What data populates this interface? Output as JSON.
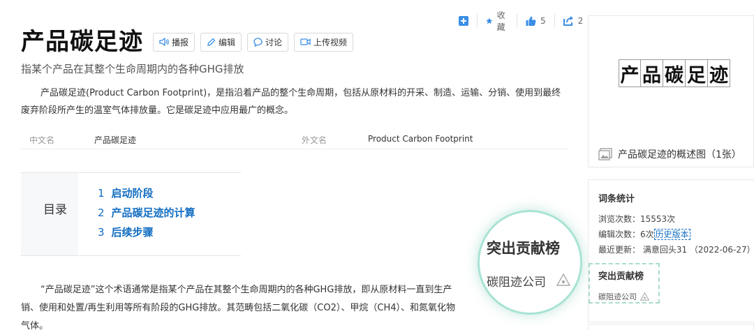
{
  "actions": {
    "collect_label": "收藏",
    "like_count": "5",
    "share_count": "2"
  },
  "title": "产品碳足迹",
  "toolbar": {
    "broadcast": "播报",
    "edit": "编辑",
    "discuss": "讨论",
    "upload_video": "上传视频"
  },
  "subtitle": "指某个产品在其整个生命周期内的各种GHG排放",
  "summary": "产品碳足迹(Product Carbon Footprint)，是指沿着产品的整个生命周期，包括从原材料的开采、制造、运输、分销、使用到最终废弃阶段所产生的温室气体排放量。它是碳足迹中应用最广的概念。",
  "basic_info": {
    "cn_name_label": "中文名",
    "cn_name_value": "产品碳足迹",
    "foreign_name_label": "外文名",
    "foreign_name_value": "Product Carbon Footprint"
  },
  "toc": {
    "label": "目录",
    "items": [
      {
        "num": "1",
        "label": "启动阶段"
      },
      {
        "num": "2",
        "label": "产品碳足迹的计算"
      },
      {
        "num": "3",
        "label": "后续步骤"
      }
    ]
  },
  "body": {
    "line1": "“产品碳足迹”这个术语通常是指某个产品在其整个生命周期内的各种GHG排放，即从原材料一直到生产",
    "line2": "销、使用和处置/再生利用等所有阶段的GHG排放。其范畴包括二氧化碳（CO2）、甲烷（CH4）、和氮氧化物",
    "line3": "气体。"
  },
  "magnifier": {
    "title": "突出贡献榜",
    "company": "碳阻迹公司"
  },
  "album": {
    "art_chars": [
      "产",
      "品",
      "碳",
      "足",
      "迹"
    ],
    "caption": "产品碳足迹的概述图（1张）"
  },
  "stats": {
    "title": "词条统计",
    "views": "浏览次数：15553次",
    "edits_prefix": "编辑次数：6次",
    "history_link": "历史版本",
    "last_update": "最近更新： 满意回头31 （2022-06-27）",
    "contrib_title": "突出贡献榜",
    "contrib_company": "碳阻迹公司"
  },
  "colors": {
    "link_blue": "#136ec2",
    "accent_green": "#a8e3d4",
    "icon_blue": "#3a8ee6"
  }
}
